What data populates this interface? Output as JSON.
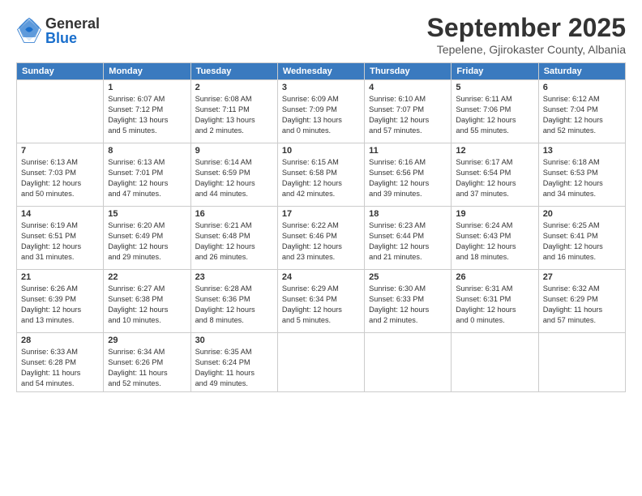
{
  "header": {
    "logo": {
      "general": "General",
      "blue": "Blue"
    },
    "title": "September 2025",
    "subtitle": "Tepelene, Gjirokaster County, Albania"
  },
  "calendar": {
    "headers": [
      "Sunday",
      "Monday",
      "Tuesday",
      "Wednesday",
      "Thursday",
      "Friday",
      "Saturday"
    ],
    "weeks": [
      [
        {
          "day": "",
          "detail": ""
        },
        {
          "day": "1",
          "detail": "Sunrise: 6:07 AM\nSunset: 7:12 PM\nDaylight: 13 hours\nand 5 minutes."
        },
        {
          "day": "2",
          "detail": "Sunrise: 6:08 AM\nSunset: 7:11 PM\nDaylight: 13 hours\nand 2 minutes."
        },
        {
          "day": "3",
          "detail": "Sunrise: 6:09 AM\nSunset: 7:09 PM\nDaylight: 13 hours\nand 0 minutes."
        },
        {
          "day": "4",
          "detail": "Sunrise: 6:10 AM\nSunset: 7:07 PM\nDaylight: 12 hours\nand 57 minutes."
        },
        {
          "day": "5",
          "detail": "Sunrise: 6:11 AM\nSunset: 7:06 PM\nDaylight: 12 hours\nand 55 minutes."
        },
        {
          "day": "6",
          "detail": "Sunrise: 6:12 AM\nSunset: 7:04 PM\nDaylight: 12 hours\nand 52 minutes."
        }
      ],
      [
        {
          "day": "7",
          "detail": "Sunrise: 6:13 AM\nSunset: 7:03 PM\nDaylight: 12 hours\nand 50 minutes."
        },
        {
          "day": "8",
          "detail": "Sunrise: 6:13 AM\nSunset: 7:01 PM\nDaylight: 12 hours\nand 47 minutes."
        },
        {
          "day": "9",
          "detail": "Sunrise: 6:14 AM\nSunset: 6:59 PM\nDaylight: 12 hours\nand 44 minutes."
        },
        {
          "day": "10",
          "detail": "Sunrise: 6:15 AM\nSunset: 6:58 PM\nDaylight: 12 hours\nand 42 minutes."
        },
        {
          "day": "11",
          "detail": "Sunrise: 6:16 AM\nSunset: 6:56 PM\nDaylight: 12 hours\nand 39 minutes."
        },
        {
          "day": "12",
          "detail": "Sunrise: 6:17 AM\nSunset: 6:54 PM\nDaylight: 12 hours\nand 37 minutes."
        },
        {
          "day": "13",
          "detail": "Sunrise: 6:18 AM\nSunset: 6:53 PM\nDaylight: 12 hours\nand 34 minutes."
        }
      ],
      [
        {
          "day": "14",
          "detail": "Sunrise: 6:19 AM\nSunset: 6:51 PM\nDaylight: 12 hours\nand 31 minutes."
        },
        {
          "day": "15",
          "detail": "Sunrise: 6:20 AM\nSunset: 6:49 PM\nDaylight: 12 hours\nand 29 minutes."
        },
        {
          "day": "16",
          "detail": "Sunrise: 6:21 AM\nSunset: 6:48 PM\nDaylight: 12 hours\nand 26 minutes."
        },
        {
          "day": "17",
          "detail": "Sunrise: 6:22 AM\nSunset: 6:46 PM\nDaylight: 12 hours\nand 23 minutes."
        },
        {
          "day": "18",
          "detail": "Sunrise: 6:23 AM\nSunset: 6:44 PM\nDaylight: 12 hours\nand 21 minutes."
        },
        {
          "day": "19",
          "detail": "Sunrise: 6:24 AM\nSunset: 6:43 PM\nDaylight: 12 hours\nand 18 minutes."
        },
        {
          "day": "20",
          "detail": "Sunrise: 6:25 AM\nSunset: 6:41 PM\nDaylight: 12 hours\nand 16 minutes."
        }
      ],
      [
        {
          "day": "21",
          "detail": "Sunrise: 6:26 AM\nSunset: 6:39 PM\nDaylight: 12 hours\nand 13 minutes."
        },
        {
          "day": "22",
          "detail": "Sunrise: 6:27 AM\nSunset: 6:38 PM\nDaylight: 12 hours\nand 10 minutes."
        },
        {
          "day": "23",
          "detail": "Sunrise: 6:28 AM\nSunset: 6:36 PM\nDaylight: 12 hours\nand 8 minutes."
        },
        {
          "day": "24",
          "detail": "Sunrise: 6:29 AM\nSunset: 6:34 PM\nDaylight: 12 hours\nand 5 minutes."
        },
        {
          "day": "25",
          "detail": "Sunrise: 6:30 AM\nSunset: 6:33 PM\nDaylight: 12 hours\nand 2 minutes."
        },
        {
          "day": "26",
          "detail": "Sunrise: 6:31 AM\nSunset: 6:31 PM\nDaylight: 12 hours\nand 0 minutes."
        },
        {
          "day": "27",
          "detail": "Sunrise: 6:32 AM\nSunset: 6:29 PM\nDaylight: 11 hours\nand 57 minutes."
        }
      ],
      [
        {
          "day": "28",
          "detail": "Sunrise: 6:33 AM\nSunset: 6:28 PM\nDaylight: 11 hours\nand 54 minutes."
        },
        {
          "day": "29",
          "detail": "Sunrise: 6:34 AM\nSunset: 6:26 PM\nDaylight: 11 hours\nand 52 minutes."
        },
        {
          "day": "30",
          "detail": "Sunrise: 6:35 AM\nSunset: 6:24 PM\nDaylight: 11 hours\nand 49 minutes."
        },
        {
          "day": "",
          "detail": ""
        },
        {
          "day": "",
          "detail": ""
        },
        {
          "day": "",
          "detail": ""
        },
        {
          "day": "",
          "detail": ""
        }
      ]
    ]
  }
}
